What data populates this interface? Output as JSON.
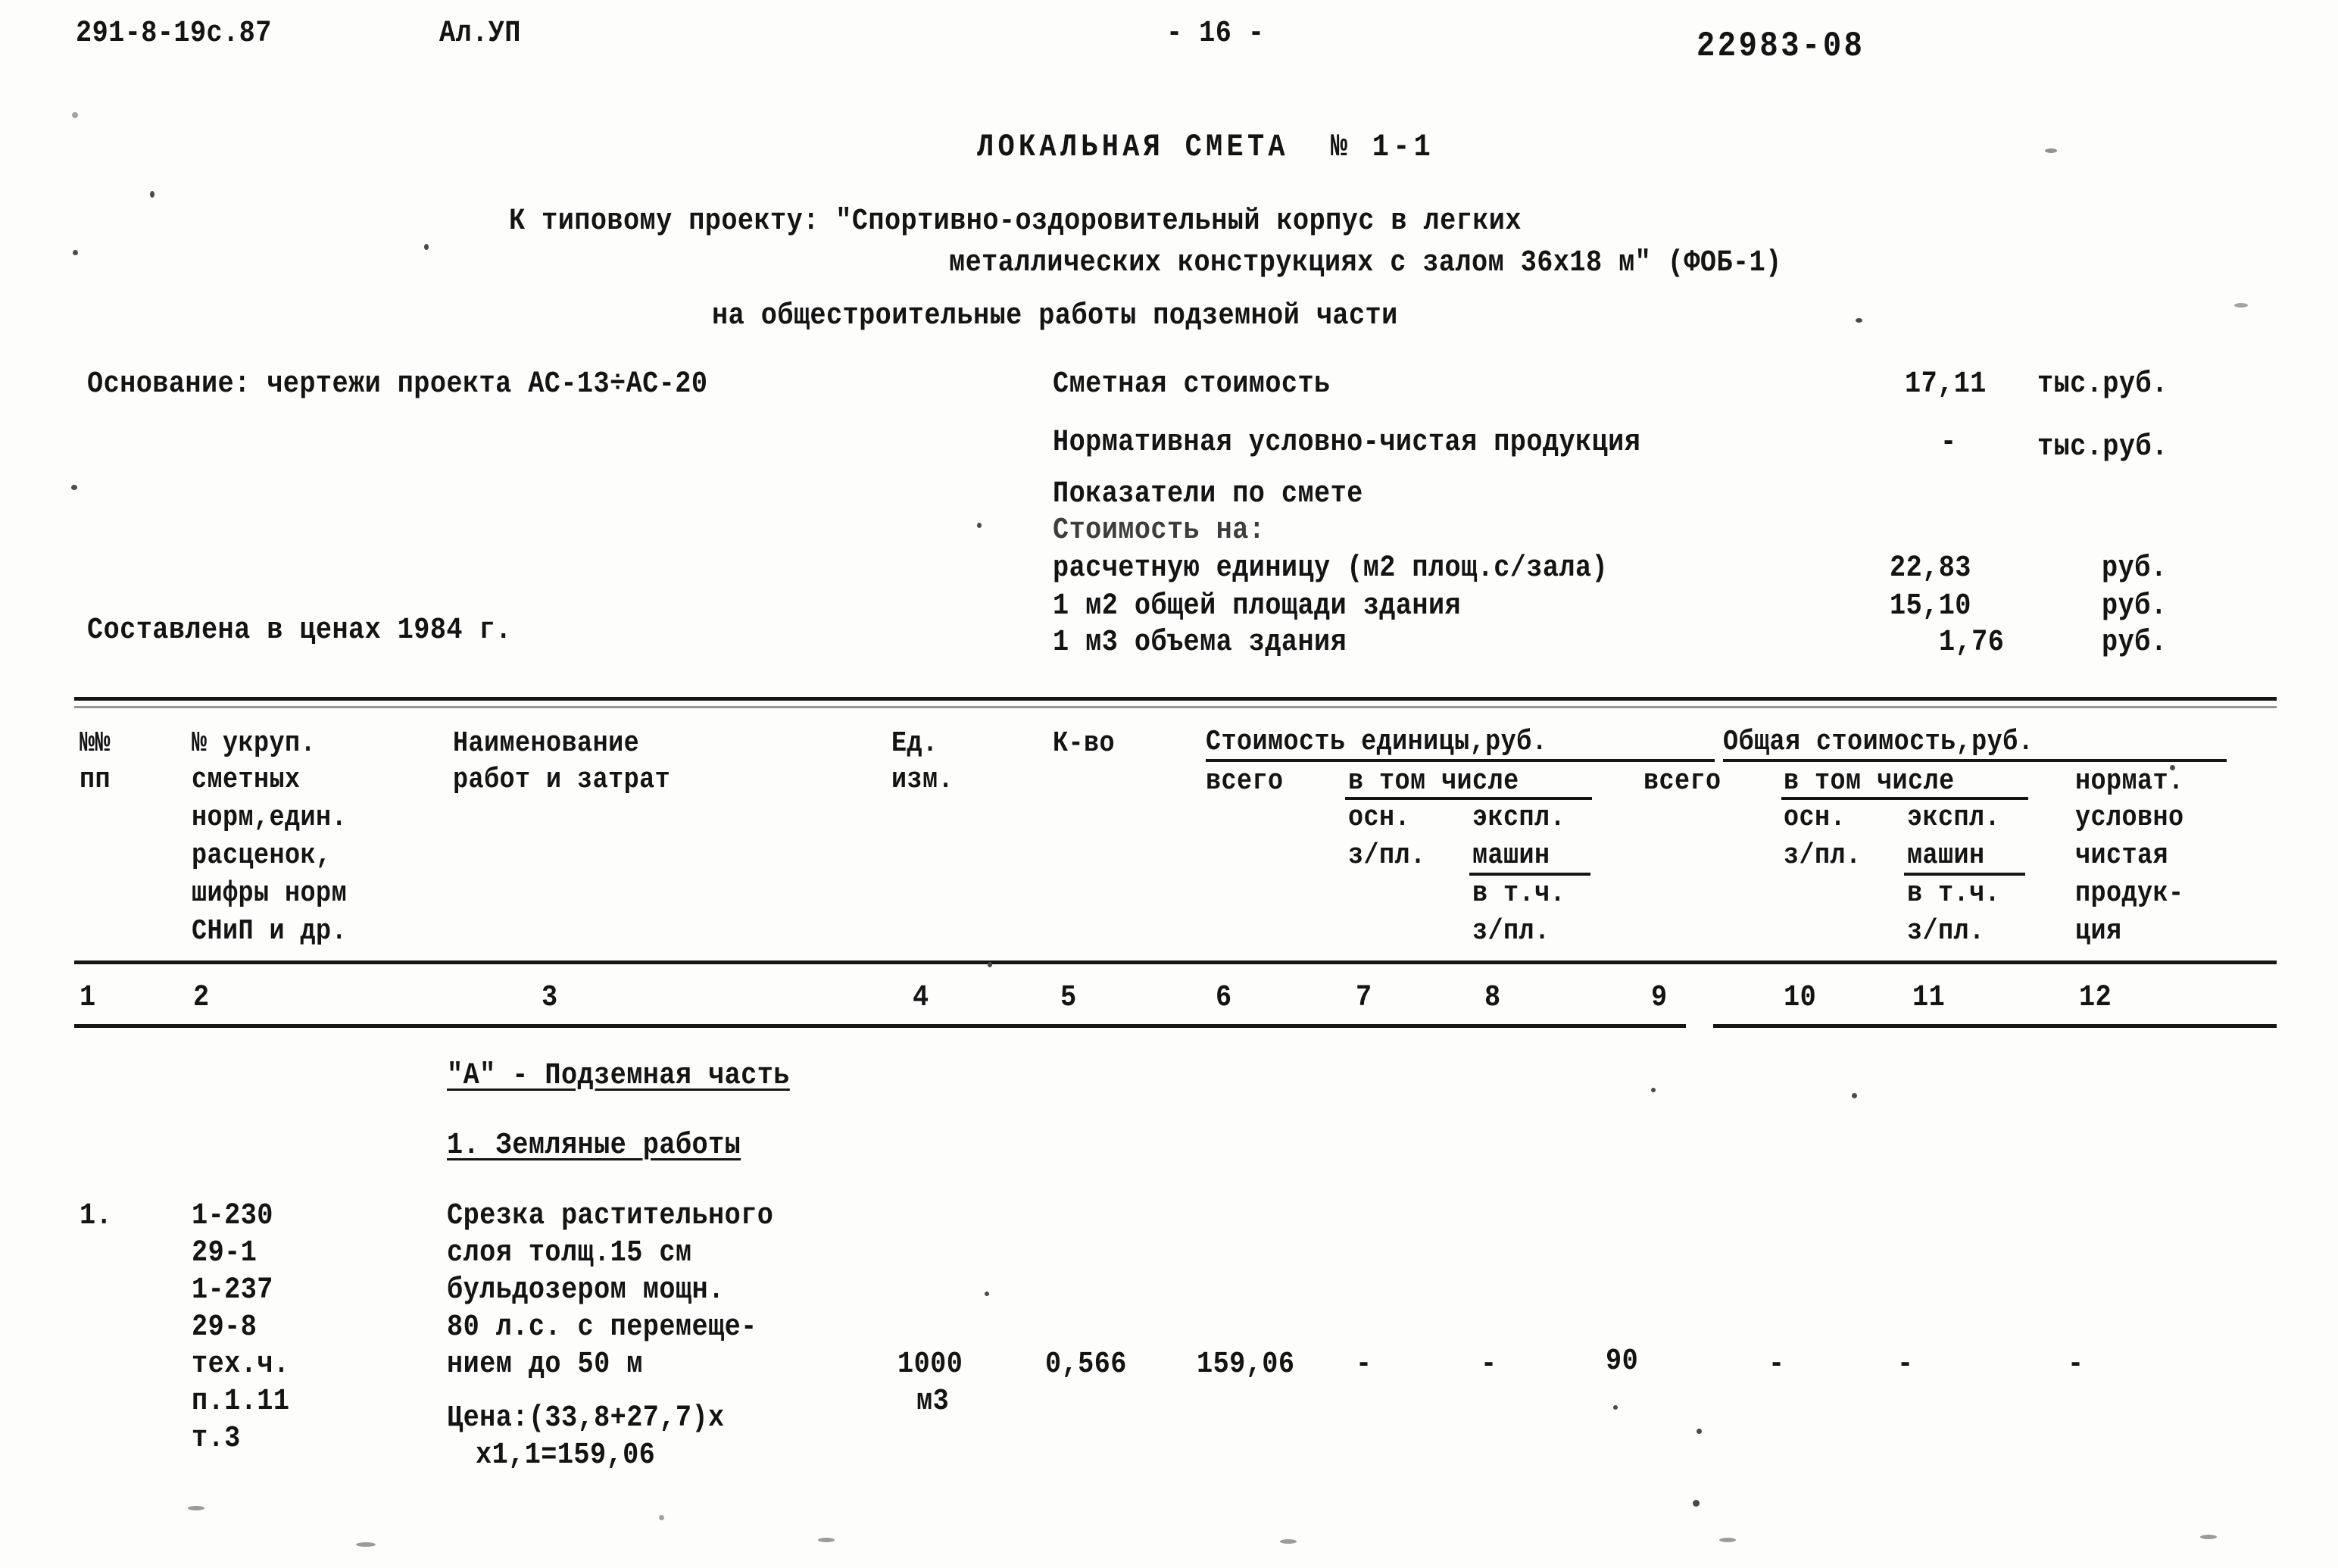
{
  "header": {
    "doc_code": "291-8-19с.87",
    "album": "Ал.УП",
    "page_number": "- 16 -",
    "archive_code": "22983-08"
  },
  "title": {
    "main": "ЛОКАЛЬНАЯ СМЕТА  № 1-1",
    "project_prefix": "К типовому проекту: \"Спортивно-оздоровительный корпус в легких",
    "project_cont": "металлических конструкциях с залом 36х18 м\" (ФОБ-1)",
    "scope": "на общестроительные работы подземной части"
  },
  "basis": {
    "label": "Основание: чертежи проекта АС-13÷АС-20",
    "prices_note": "Составлена в ценах 1984 г."
  },
  "summary": {
    "estimate_cost_label": "Сметная стоимость",
    "estimate_cost_value": "17,11",
    "estimate_cost_unit": "тыс.руб.",
    "ncp_label": "Нормативная условно-чистая продукция",
    "ncp_value": "-",
    "ncp_unit": "тыс.руб.",
    "indicators_label": "Показатели по смете",
    "cost_per_label": "Стоимость на:",
    "rows": [
      {
        "label": "расчетную единицу (м2 площ.с/зала)",
        "value": "22,83",
        "unit": "руб."
      },
      {
        "label": "1 м2 общей площади здания",
        "value": "15,10",
        "unit": "руб."
      },
      {
        "label": "1 м3 объема здания",
        "value": "1,76",
        "unit": "руб."
      }
    ]
  },
  "table": {
    "head": {
      "c1_l1": "№№",
      "c1_l2": "пп",
      "c2_l1": "№ укруп.",
      "c2_l2": "сметных",
      "c2_l3": "норм,един.",
      "c2_l4": "расценок,",
      "c2_l5": "шифры норм",
      "c2_l6": "СНиП и др.",
      "c3_l1": "Наименование",
      "c3_l2": "работ и затрат",
      "c4_l1": "Ед.",
      "c4_l2": "изм.",
      "c5_l1": "К-во",
      "group_unit_cost": "Стоимость единицы,руб.",
      "group_total_cost": "Общая стоимость,руб.",
      "vsego_a": "всего",
      "vtomchisle_a": "в том числе",
      "osn_a": "осн.",
      "ekspl_a": "экспл.",
      "zpl_a": "з/пл.",
      "mashin_a": "машин",
      "vtch_a": "в т.ч.",
      "zpl2_a": "з/пл.",
      "vsego_b": "всего",
      "vtomchisle_b": "в том числе",
      "osn_b": "осн.",
      "ekspl_b": "экспл.",
      "zpl_b": "з/пл.",
      "mashin_b": "машин",
      "vtch_b": "в т.ч.",
      "zpl2_b": "з/пл.",
      "c12_l1": "нормат.",
      "c12_l2": "условно",
      "c12_l3": "чистая",
      "c12_l4": "продук-",
      "c12_l5": "ция"
    },
    "column_numbers": [
      "1",
      "2",
      "3",
      "4",
      "5",
      "6",
      "7",
      "8",
      "9",
      "10",
      "11",
      "12"
    ],
    "sections": [
      {
        "title": "\"А\" - Подземная часть"
      },
      {
        "title": "1. Земляные работы"
      }
    ],
    "rows": [
      {
        "no": "1.",
        "codes": [
          "1-230",
          "29-1",
          "1-237",
          "29-8",
          "тех.ч.",
          "п.1.11",
          "т.3"
        ],
        "name_lines": [
          "Срезка растительного",
          "слоя толщ.15 см",
          "бульдозером мощн.",
          "80 л.с. с перемеще-",
          "нием до 50 м"
        ],
        "price_note_lines": [
          "Цена:(33,8+27,7)х",
          "х1,1=159,06"
        ],
        "unit_l1": "1000",
        "unit_l2": "м3",
        "qty": "0,566",
        "c6": "159,06",
        "c7": "-",
        "c8": "-",
        "c9": "90",
        "c10": "-",
        "c11": "-",
        "c12": "-"
      }
    ]
  }
}
